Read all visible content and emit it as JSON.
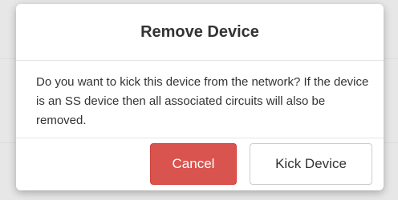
{
  "dialog": {
    "title": "Remove Device",
    "message": "Do you want to kick this device from the network? If the device is an SS device then all associated circuits will also be removed.",
    "cancel_label": "Cancel",
    "confirm_label": "Kick Device"
  },
  "colors": {
    "cancel_background": "#d9534f",
    "confirm_background": "#ffffff",
    "overlay_background": "#e7e7e7"
  }
}
